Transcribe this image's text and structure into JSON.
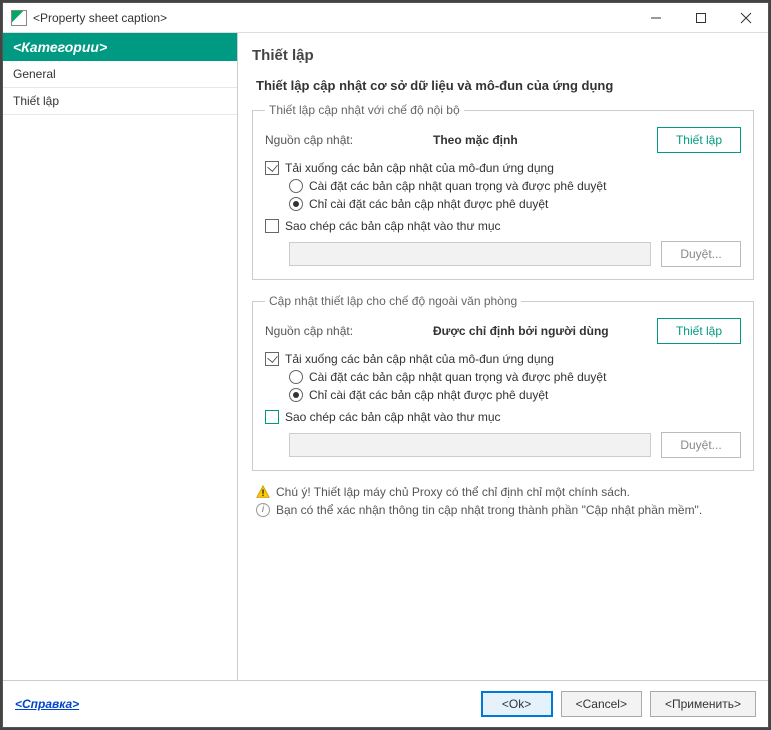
{
  "title": "<Property sheet caption>",
  "sidebar": {
    "header": "<Категории>",
    "items": [
      "General",
      "Thiết lập"
    ],
    "selected_index": 1
  },
  "page": {
    "title": "Thiết lập",
    "section_title": "Thiết lập cập nhật cơ sở dữ liệu và mô-đun của ứng dụng"
  },
  "group_internal": {
    "legend": "Thiết lập cập nhật với chế độ nội bộ",
    "source_label": "Nguồn cập nhật:",
    "source_value": "Theo mặc định",
    "setup_btn": "Thiết lập",
    "check_download": {
      "label": "Tải xuống các bản cập nhật của mô-đun ứng dụng",
      "checked": true
    },
    "radio_important": {
      "label": "Cài đặt các bản cập nhật quan trọng và được phê duyệt",
      "checked": false
    },
    "radio_approved": {
      "label": "Chỉ cài đặt các bản cập nhật được phê duyệt",
      "checked": true
    },
    "check_copy": {
      "label": "Sao chép các bản cập nhật vào thư mục",
      "checked": false
    },
    "browse_btn": "Duyệt..."
  },
  "group_external": {
    "legend": "Cập nhật thiết lập cho chế độ ngoài văn phòng",
    "source_label": "Nguồn cập nhật:",
    "source_value": "Được chỉ định bởi người dùng",
    "setup_btn": "Thiết lập",
    "check_download": {
      "label": "Tải xuống các bản cập nhật của mô-đun ứng dụng",
      "checked": true
    },
    "radio_important": {
      "label": "Cài đặt các bản cập nhật quan trọng và được phê duyệt",
      "checked": false
    },
    "radio_approved": {
      "label": "Chỉ cài đặt các bản cập nhật được phê duyệt",
      "checked": true
    },
    "check_copy": {
      "label": "Sao chép các bản cập nhật vào thư mục",
      "checked": false
    },
    "browse_btn": "Duyệt..."
  },
  "notes": {
    "warn": "Chú ý! Thiết lập máy chủ Proxy có thể chỉ định chỉ một chính sách.",
    "info": "Bạn có thể xác nhận thông tin cập nhật trong thành phần \"Cập nhật phần mềm\"."
  },
  "footer": {
    "help": "<Справка>",
    "ok": "<Ok>",
    "cancel": "<Cancel>",
    "apply": "<Применить>"
  }
}
